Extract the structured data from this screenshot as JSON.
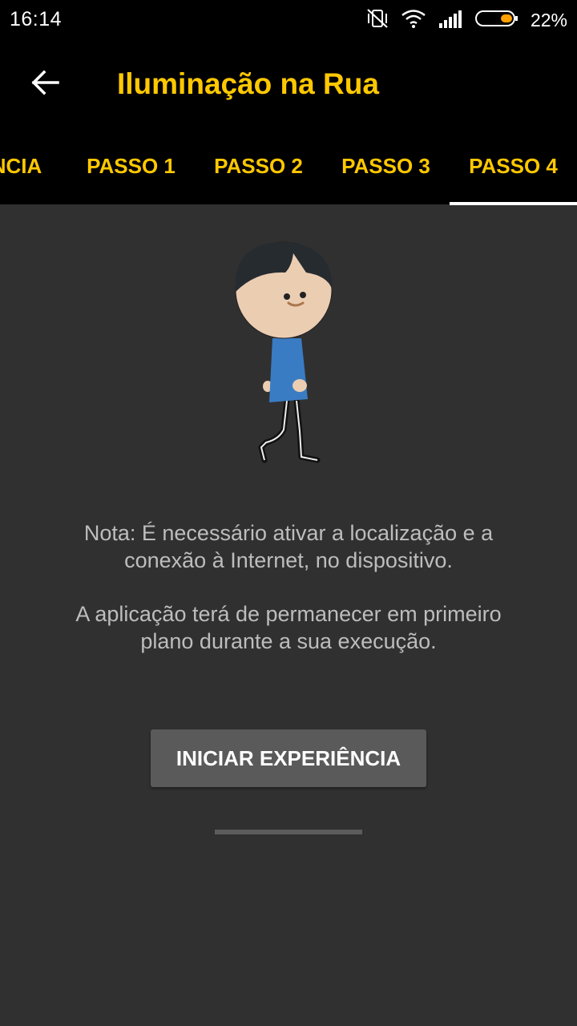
{
  "status_bar": {
    "time": "16:14",
    "battery_percent": "22%",
    "icons": [
      "vibrate-off-icon",
      "wifi-icon",
      "signal-icon",
      "battery-icon"
    ]
  },
  "app_bar": {
    "title": "Iluminação na Rua",
    "back_icon": "arrow-left-icon",
    "accent_color": "#FFC800"
  },
  "tabs": [
    {
      "label": "NCIA",
      "selected": false
    },
    {
      "label": "PASSO 1",
      "selected": false
    },
    {
      "label": "PASSO 2",
      "selected": false
    },
    {
      "label": "PASSO 3",
      "selected": false
    },
    {
      "label": "PASSO 4",
      "selected": true
    }
  ],
  "main": {
    "note_line": "Nota: É necessário ativar a localização e a conexão à Internet, no dispositivo.",
    "info_line": "A aplicação terá de permanecer em primeiro plano durante a sua execução.",
    "start_button": "INICIAR EXPERIÊNCIA"
  }
}
